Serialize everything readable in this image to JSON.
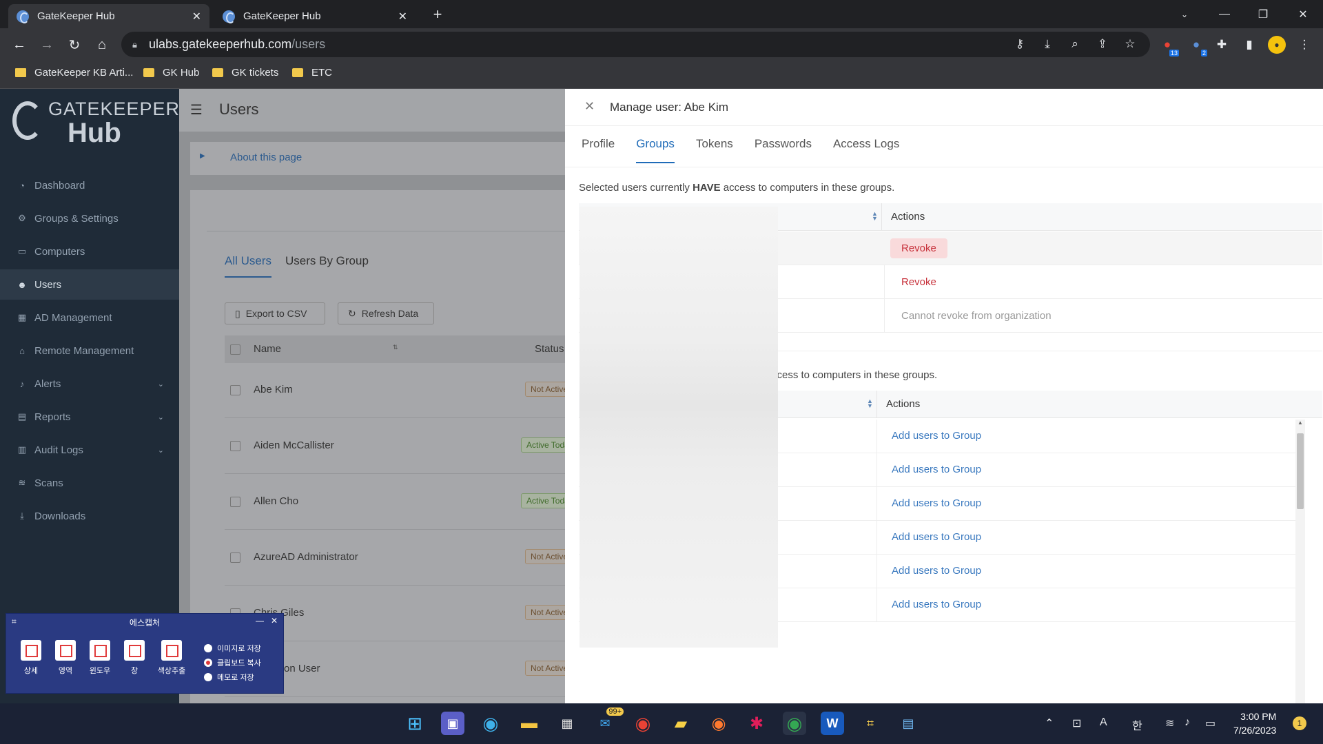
{
  "browser": {
    "tabs": [
      {
        "title": "GateKeeper Hub"
      },
      {
        "title": "GateKeeper Hub"
      }
    ],
    "url_host": "ulabs.gatekeeperhub.com",
    "url_path": "/users",
    "extension_badges": {
      "ext1": "13",
      "ext2": "2"
    },
    "bookmarks": [
      "GateKeeper KB Arti...",
      "GK Hub",
      "GK tickets",
      "ETC"
    ]
  },
  "sidebar": {
    "logo_line1": "GATEKEEPER",
    "logo_line2": "Hub",
    "items": [
      {
        "label": "Dashboard",
        "icon": "dashboard-icon"
      },
      {
        "label": "Groups & Settings",
        "icon": "gears-icon"
      },
      {
        "label": "Computers",
        "icon": "laptop-icon"
      },
      {
        "label": "Users",
        "icon": "users-icon"
      },
      {
        "label": "AD Management",
        "icon": "grid-icon"
      },
      {
        "label": "Remote Management",
        "icon": "bank-icon"
      },
      {
        "label": "Alerts",
        "icon": "bell-icon"
      },
      {
        "label": "Reports",
        "icon": "document-icon"
      },
      {
        "label": "Audit Logs",
        "icon": "table-icon"
      },
      {
        "label": "Scans",
        "icon": "wifi-icon"
      },
      {
        "label": "Downloads",
        "icon": "download-icon"
      }
    ]
  },
  "page": {
    "title": "Users",
    "about": "About this page",
    "tabs": [
      "All Users",
      "Users By Group"
    ],
    "export_btn": "Export to CSV",
    "refresh_btn": "Refresh Data",
    "columns": {
      "name": "Name",
      "status": "Status"
    },
    "users": [
      {
        "name": "Abe Kim",
        "status": "Not Active"
      },
      {
        "name": "Aiden McCallister",
        "status": "Active Toda"
      },
      {
        "name": "Allen Cho",
        "status": "Active Toda"
      },
      {
        "name": "AzureAD Administrator",
        "status": "Not Active"
      },
      {
        "name": "Chris Giles",
        "status": "Not Active"
      },
      {
        "name": "on User",
        "status": "Not Active"
      }
    ]
  },
  "drawer": {
    "title": "Manage user: Abe Kim",
    "tabs": [
      "Profile",
      "Groups",
      "Tokens",
      "Passwords",
      "Access Logs"
    ],
    "have_text_pre": "Selected users currently ",
    "have_text_bold": "HAVE",
    "have_text_post": " access to computers in these groups.",
    "actions_header": "Actions",
    "have_actions": [
      "Revoke",
      "Revoke",
      "Cannot revoke from organization"
    ],
    "not_have_text": "ccess to computers in these groups.",
    "add_actions": [
      "Add users to Group",
      "Add users to Group",
      "Add users to Group",
      "Add users to Group",
      "Add users to Group",
      "Add users to Group"
    ]
  },
  "capture_widget": {
    "title": "에스캡처",
    "buttons": [
      "상세",
      "영역",
      "윈도우",
      "창",
      "색상추출"
    ],
    "options": [
      "이미지로 저장",
      "클립보드 복사",
      "메모로 저장"
    ],
    "selected_option": 1
  },
  "taskbar": {
    "mail_badge": "99+",
    "clock_time": "3:00 PM",
    "clock_date": "7/26/2023",
    "notification_count": "1",
    "ime": "한"
  },
  "colors": {
    "accent": "#1f6bb8",
    "danger": "#c7303a",
    "sidebar": "#1f2b38"
  }
}
